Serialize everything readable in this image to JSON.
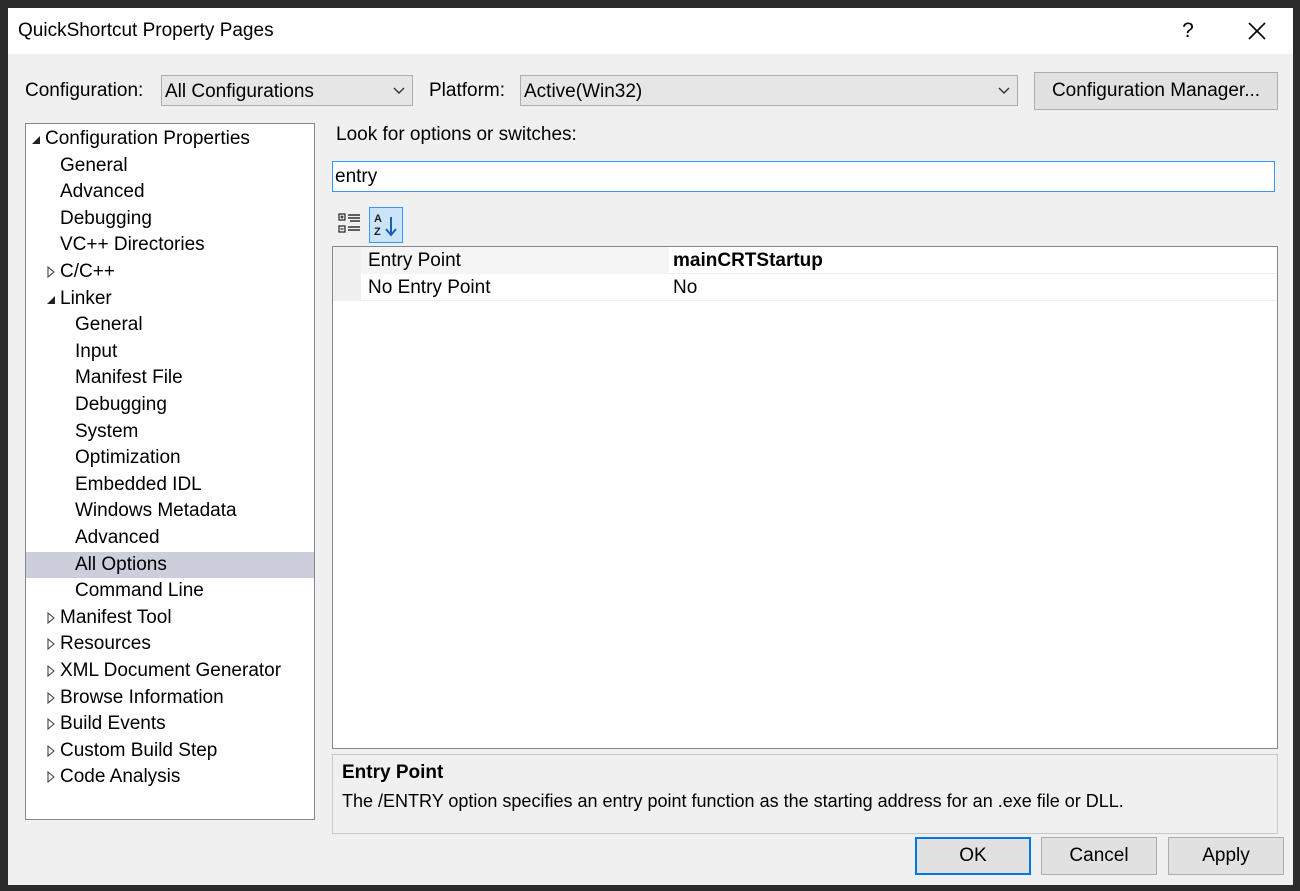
{
  "window": {
    "title": "QuickShortcut Property Pages",
    "help_label": "?",
    "close_icon": "close-icon"
  },
  "toolbar": {
    "configuration_label": "Configuration:",
    "configuration_value": "All Configurations",
    "platform_label": "Platform:",
    "platform_value": "Active(Win32)",
    "config_manager_label": "Configuration Manager..."
  },
  "tree": {
    "items": [
      {
        "label": "Configuration Properties",
        "level": 0,
        "twisty": "expanded"
      },
      {
        "label": "General",
        "level": 1,
        "twisty": "none"
      },
      {
        "label": "Advanced",
        "level": 1,
        "twisty": "none"
      },
      {
        "label": "Debugging",
        "level": 1,
        "twisty": "none"
      },
      {
        "label": "VC++ Directories",
        "level": 1,
        "twisty": "none"
      },
      {
        "label": "C/C++",
        "level": 1,
        "twisty": "collapsed"
      },
      {
        "label": "Linker",
        "level": 1,
        "twisty": "expanded"
      },
      {
        "label": "General",
        "level": 2,
        "twisty": "none"
      },
      {
        "label": "Input",
        "level": 2,
        "twisty": "none"
      },
      {
        "label": "Manifest File",
        "level": 2,
        "twisty": "none"
      },
      {
        "label": "Debugging",
        "level": 2,
        "twisty": "none"
      },
      {
        "label": "System",
        "level": 2,
        "twisty": "none"
      },
      {
        "label": "Optimization",
        "level": 2,
        "twisty": "none"
      },
      {
        "label": "Embedded IDL",
        "level": 2,
        "twisty": "none"
      },
      {
        "label": "Windows Metadata",
        "level": 2,
        "twisty": "none"
      },
      {
        "label": "Advanced",
        "level": 2,
        "twisty": "none"
      },
      {
        "label": "All Options",
        "level": 2,
        "twisty": "none",
        "selected": true
      },
      {
        "label": "Command Line",
        "level": 2,
        "twisty": "none"
      },
      {
        "label": "Manifest Tool",
        "level": 1,
        "twisty": "collapsed"
      },
      {
        "label": "Resources",
        "level": 1,
        "twisty": "collapsed"
      },
      {
        "label": "XML Document Generator",
        "level": 1,
        "twisty": "collapsed"
      },
      {
        "label": "Browse Information",
        "level": 1,
        "twisty": "collapsed"
      },
      {
        "label": "Build Events",
        "level": 1,
        "twisty": "collapsed"
      },
      {
        "label": "Custom Build Step",
        "level": 1,
        "twisty": "collapsed"
      },
      {
        "label": "Code Analysis",
        "level": 1,
        "twisty": "collapsed"
      }
    ]
  },
  "search": {
    "label": "Look for options or switches:",
    "value": "entry"
  },
  "grid_tools": {
    "categorized_icon": "categorized-view-icon",
    "alphabetical_icon": "sort-alphabetical-icon"
  },
  "properties": [
    {
      "name": "Entry Point",
      "value": "mainCRTStartup",
      "bold": true
    },
    {
      "name": "No Entry Point",
      "value": "No",
      "bold": false
    }
  ],
  "description": {
    "title": "Entry Point",
    "text": "The /ENTRY option specifies an entry point function as the starting address for an .exe file or DLL."
  },
  "buttons": {
    "ok": "OK",
    "cancel": "Cancel",
    "apply": "Apply"
  },
  "colors": {
    "selection": "#cccedb",
    "focus_border": "#3399ff",
    "default_button_border": "#0078d7"
  }
}
